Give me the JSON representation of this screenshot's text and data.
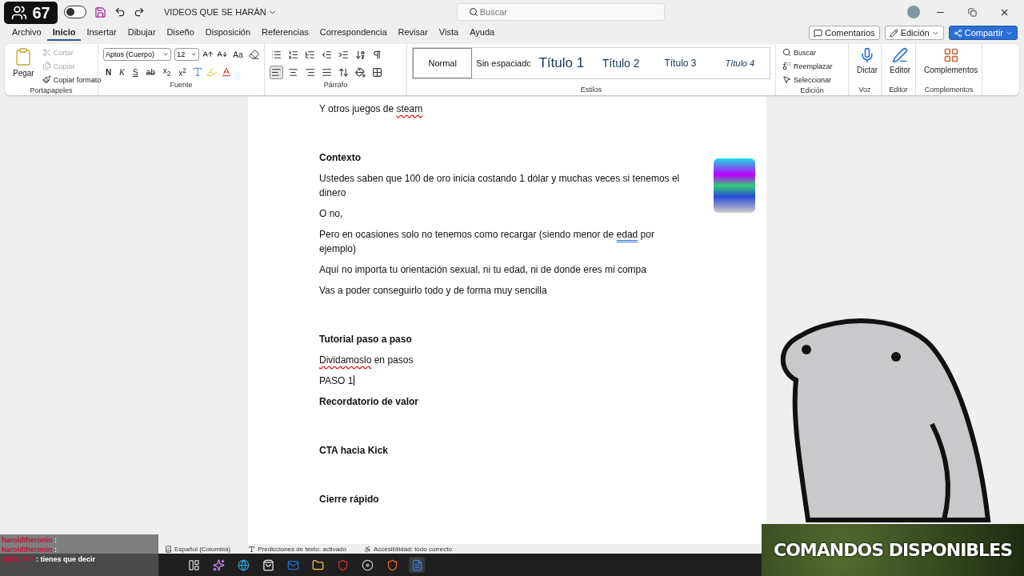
{
  "viewer_badge": {
    "count": "67"
  },
  "title_bar": {
    "autosave_on": false,
    "document_title": "VIDEOS QUE SE HARÁN",
    "search": {
      "placeholder": "Buscar"
    }
  },
  "menu_tabs": [
    {
      "label": "Archivo",
      "selected": false
    },
    {
      "label": "Inicio",
      "selected": true
    },
    {
      "label": "Insertar",
      "selected": false
    },
    {
      "label": "Dibujar",
      "selected": false
    },
    {
      "label": "Diseño",
      "selected": false
    },
    {
      "label": "Disposición",
      "selected": false
    },
    {
      "label": "Referencias",
      "selected": false
    },
    {
      "label": "Correspondencia",
      "selected": false
    },
    {
      "label": "Revisar",
      "selected": false
    },
    {
      "label": "Vista",
      "selected": false
    },
    {
      "label": "Ayuda",
      "selected": false
    }
  ],
  "header_buttons": [
    {
      "label": "Comentarios",
      "kind": "comments"
    },
    {
      "label": "Edición",
      "kind": "mode"
    },
    {
      "label": "Compartir",
      "kind": "share"
    }
  ],
  "ribbon": {
    "clipboard": {
      "label": "Portapapeles",
      "paste": "Pegar",
      "actions": [
        {
          "label": "Cortar",
          "disabled": true
        },
        {
          "label": "Copiar",
          "disabled": true
        },
        {
          "label": "Copiar formato",
          "disabled": false
        }
      ]
    },
    "font": {
      "label": "Fuente",
      "font_name": "Aptos (Cuerpo)",
      "font_size": "12",
      "case_button": "Aa",
      "format_buttons": [
        {
          "label": "N",
          "kind": "bold"
        },
        {
          "label": "K",
          "kind": "italic"
        },
        {
          "label": "S",
          "kind": "underline"
        },
        {
          "label": "ab",
          "kind": "strike"
        },
        {
          "label": "x$_{2}$",
          "kind": "plain"
        },
        {
          "label": "x$^{2}$",
          "kind": "plain"
        }
      ]
    },
    "paragraph": {
      "label": "Párrafo",
      "alignments": [
        {
          "selected": true
        },
        {
          "selected": false
        },
        {
          "selected": false
        },
        {
          "selected": false
        }
      ]
    },
    "styles": {
      "label": "Estilos",
      "items": [
        {
          "label": "Normal",
          "kind": "normal",
          "selected": true
        },
        {
          "label": "Sin espaciadc",
          "kind": "normal",
          "selected": false
        },
        {
          "label": "Título 1",
          "kind": "h1",
          "selected": false
        },
        {
          "label": "Título 2",
          "kind": "h2",
          "selected": false
        },
        {
          "label": "Título 3",
          "kind": "h3",
          "selected": false
        },
        {
          "label": "Título 4",
          "kind": "h4",
          "selected": false
        }
      ]
    },
    "editing": {
      "label": "Edición",
      "items": [
        "Buscar",
        "Reemplazar",
        "Seleccionar"
      ]
    },
    "voice": {
      "label": "Voz",
      "button": "Dictar"
    },
    "editor": {
      "label": "Editor",
      "button": "Editor"
    },
    "addins": {
      "label": "Complementos",
      "button": "Complementos"
    }
  },
  "document": {
    "paragraphs": [
      {
        "kind": "normal",
        "parts": [
          {
            "text": "Y otros juegos de "
          },
          {
            "text": "steam",
            "misspelled": true
          }
        ]
      },
      {
        "kind": "blank"
      },
      {
        "kind": "heading",
        "parts": [
          {
            "text": "Contexto"
          }
        ]
      },
      {
        "kind": "normal",
        "parts": [
          {
            "text": "Ustedes saben que 100 de oro inicia costando 1 dólar y muchas veces si tenemos el dinero"
          }
        ]
      },
      {
        "kind": "normal",
        "parts": [
          {
            "text": "O no,"
          }
        ]
      },
      {
        "kind": "normal",
        "parts": [
          {
            "text": "Pero en ocasiones solo no tenemos como recargar (siendo menor de "
          },
          {
            "text": "edad",
            "grammar_flag": true
          },
          {
            "text": " por ejemplo)"
          }
        ]
      },
      {
        "kind": "normal",
        "parts": [
          {
            "text": "Aquí no importa tu orientación sexual, ni tu edad, ni de donde eres mi compa"
          }
        ]
      },
      {
        "kind": "normal",
        "parts": [
          {
            "text": "Vas a poder conseguirlo todo y de forma muy sencilla"
          }
        ]
      },
      {
        "kind": "blank"
      },
      {
        "kind": "heading",
        "parts": [
          {
            "text": "Tutorial paso a paso"
          }
        ]
      },
      {
        "kind": "normal",
        "parts": [
          {
            "text": "Dividamoslo",
            "misspelled": true
          },
          {
            "text": " en pasos"
          }
        ]
      },
      {
        "kind": "normal",
        "cursor": true,
        "parts": [
          {
            "text": "PASO 1"
          }
        ]
      },
      {
        "kind": "heading",
        "parts": [
          {
            "text": "Recordatorio de valor"
          }
        ]
      },
      {
        "kind": "blank"
      },
      {
        "kind": "heading",
        "parts": [
          {
            "text": "CTA hacia Kick"
          }
        ]
      },
      {
        "kind": "blank"
      },
      {
        "kind": "heading",
        "parts": [
          {
            "text": "Cierre rápido"
          }
        ]
      }
    ]
  },
  "status_bar": [
    "Español (Colombia)",
    "Predicciones de texto: activado",
    "Accesibilidad: todo correcto"
  ],
  "chat": [
    {
      "user": "haroldtheronin",
      "text": ":"
    },
    {
      "user": "haroldtheronin",
      "text": ":"
    },
    {
      "user": "Millo2707",
      "text": ": tienes que decir"
    }
  ],
  "banner": {
    "title": "COMANDOS DISPONIBLES"
  }
}
